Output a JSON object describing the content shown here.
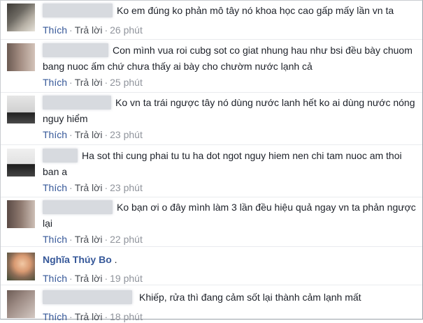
{
  "comments": [
    {
      "author": "",
      "text": "Ko em đúng ko phản mô tây nó khoa học cao gấp mấy lần vn ta",
      "like": "Thích",
      "reply": "Trả lời",
      "time": "26 phút"
    },
    {
      "author": "",
      "text": "Con mình vua roi cubg sot co giat nhung hau như bsi đều bày chuom bang nuoc ấm chứ chưa thấy ai bày cho chườm nước lạnh cả",
      "like": "Thích",
      "reply": "Trả lời",
      "time": "25 phút"
    },
    {
      "author": "",
      "text": "Ko vn ta trái ngược tây nó dùng nước lanh hết ko ai dùng nước nóng nguy hiểm",
      "like": "Thích",
      "reply": "Trả lời",
      "time": "23 phút"
    },
    {
      "author": "",
      "text": "Ha sot thi cung phai tu tu ha dot ngot nguy hiem nen chi tam nuoc am thoi ban a",
      "like": "Thích",
      "reply": "Trả lời",
      "time": "23 phút"
    },
    {
      "author": "",
      "text": "Ko bạn ơi o đây mình làm 3 lần đều hiệu quả ngay vn ta phản ngược lại",
      "like": "Thích",
      "reply": "Trả lời",
      "time": "22 phút"
    },
    {
      "author": "Nghĩa Thúy Bo",
      "text": ".",
      "like": "Thích",
      "reply": "Trả lời",
      "time": "19 phút"
    },
    {
      "author": "",
      "text": "Khiếp, rửa thì đang cảm sốt lại thành cảm lạnh mất",
      "like": "Thích",
      "reply": "Trả lời",
      "time": "18 phút"
    }
  ],
  "colors": {
    "link": "#365899",
    "meta": "#90949c",
    "text": "#1d2129",
    "blur": "#d7dadf"
  }
}
